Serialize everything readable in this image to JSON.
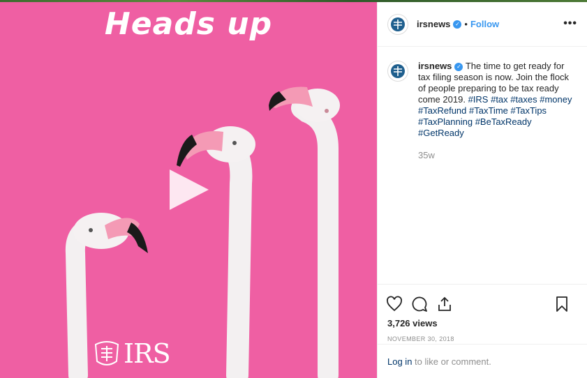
{
  "media": {
    "title": "Heads up",
    "logo_text": "IRS",
    "colors": {
      "background": "#ef5fa3"
    }
  },
  "post": {
    "username": "irsnews",
    "follow_label": "Follow",
    "separator": "•",
    "more_label": "•••",
    "caption_text": "The time to get ready for tax filing season is now. Join the flock of people preparing to be tax ready come 2019.",
    "hashtags": [
      "#IRS",
      "#tax",
      "#taxes",
      "#money",
      "#TaxRefund",
      "#TaxTime",
      "#TaxTips",
      "#TaxPlanning",
      "#BeTaxReady",
      "#GetReady"
    ],
    "age": "35w",
    "views": "3,726 views",
    "date": "NOVEMBER 30, 2018",
    "login_link": "Log in",
    "login_suffix": " to like or comment."
  },
  "icons": [
    "verified-badge-icon",
    "heart-icon",
    "comment-icon",
    "share-icon",
    "bookmark-icon",
    "play-icon",
    "irs-eagle-icon"
  ],
  "accent": "#3897f0"
}
